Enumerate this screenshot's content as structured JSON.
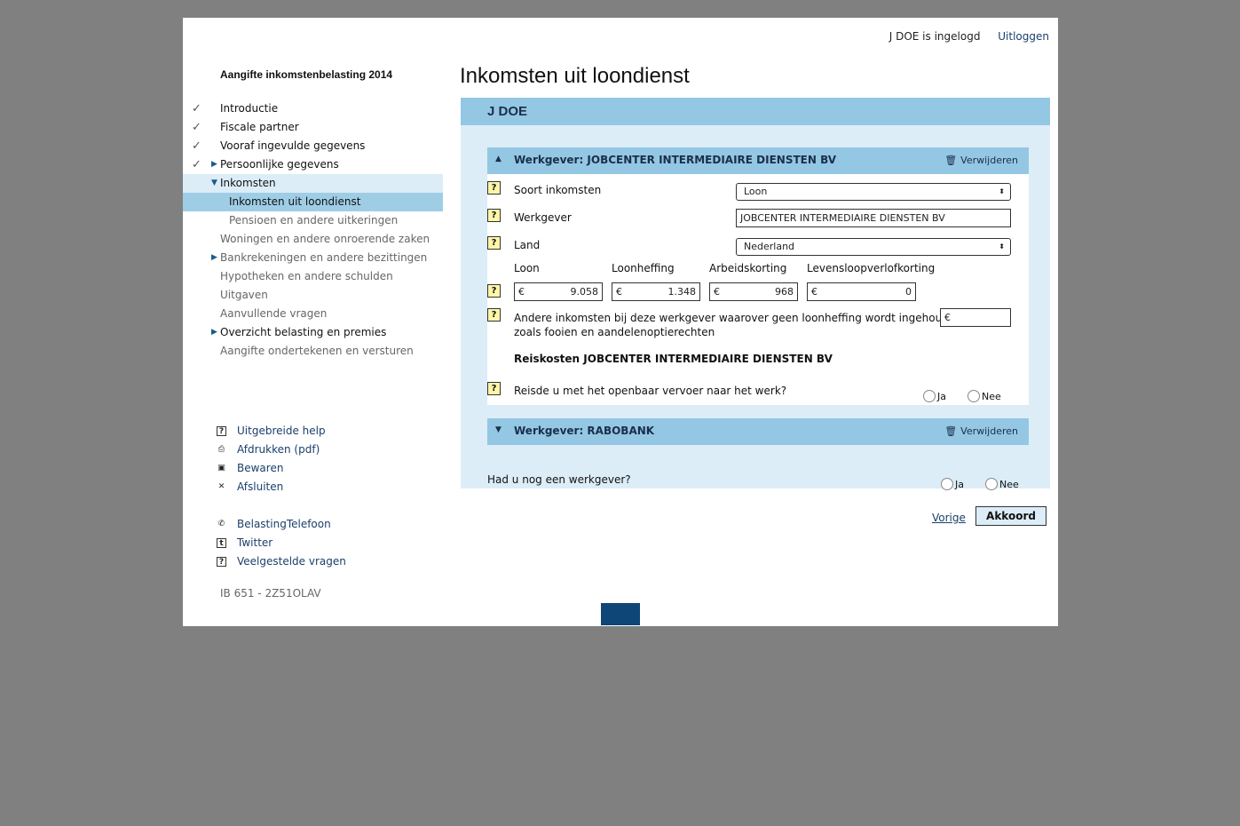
{
  "header": {
    "user_status": "J DOE is ingelogd",
    "logout": "Uitloggen",
    "app_title": "Aangifte inkomstenbelasting 2014"
  },
  "nav": {
    "items": [
      {
        "label": "Introductie",
        "check": "✓",
        "state": "done"
      },
      {
        "label": "Fiscale partner",
        "check": "✓",
        "state": "done"
      },
      {
        "label": "Vooraf ingevulde gegevens",
        "check": "✓",
        "state": "done"
      },
      {
        "label": "Persoonlijke gegevens",
        "check": "✓",
        "state": "done",
        "expander": "▶"
      },
      {
        "label": "Inkomsten",
        "state": "open",
        "expander": "▼"
      },
      {
        "label": "Inkomsten uit loondienst",
        "state": "active",
        "sub": true
      },
      {
        "label": "Pensioen en andere uitkeringen",
        "state": "dim",
        "sub": true
      },
      {
        "label": "Woningen en andere onroerende zaken",
        "state": "dim"
      },
      {
        "label": "Bankrekeningen en andere bezittingen",
        "state": "dim",
        "expander": "▶"
      },
      {
        "label": "Hypotheken en andere schulden",
        "state": "dim"
      },
      {
        "label": "Uitgaven",
        "state": "dim"
      },
      {
        "label": "Aanvullende vragen",
        "state": "dim"
      },
      {
        "label": "Overzicht belasting en premies",
        "state": "normal",
        "expander": "▶"
      },
      {
        "label": "Aangifte ondertekenen en versturen",
        "state": "dim"
      }
    ]
  },
  "tools": [
    {
      "label": "Uitgebreide help",
      "icon": "?",
      "icon_name": "help-icon"
    },
    {
      "label": "Afdrukken (pdf)",
      "icon": "⎙",
      "icon_name": "print-icon"
    },
    {
      "label": "Bewaren",
      "icon": "▣",
      "icon_name": "save-icon"
    },
    {
      "label": "Afsluiten",
      "icon": "✕",
      "icon_name": "close-icon"
    }
  ],
  "links": [
    {
      "label": "BelastingTelefoon",
      "icon": "✆",
      "icon_name": "phone-icon"
    },
    {
      "label": "Twitter",
      "icon": "t",
      "icon_name": "twitter-icon"
    },
    {
      "label": "Veelgestelde vragen",
      "icon": "?",
      "icon_name": "faq-icon"
    }
  ],
  "version": "IB 651 - 2Z51OLAV",
  "main": {
    "title": "Inkomsten uit loondienst",
    "person": "J DOE",
    "employer1": {
      "title": "Werkgever: JOBCENTER INTERMEDIAIRE DIENSTEN BV",
      "toggle": "▲",
      "delete": "Verwijderen",
      "help": "?",
      "soort_label": "Soort inkomsten",
      "soort_value": "Loon",
      "werkgever_label": "Werkgever",
      "werkgever_value": "JOBCENTER INTERMEDIAIRE DIENSTEN BV",
      "land_label": "Land",
      "land_value": "Nederland",
      "select_arrow": "⬍",
      "currency": "€",
      "amounts": [
        {
          "label": "Loon",
          "value": "9.058"
        },
        {
          "label": "Loonheffing",
          "value": "1.348"
        },
        {
          "label": "Arbeidskorting",
          "value": "968"
        },
        {
          "label": "Levensloopverlofkorting",
          "value": "0"
        }
      ],
      "other_income_line1": "Andere inkomsten bij deze werkgever waarover geen loonheffing wordt ingehouden,",
      "other_income_line2": "zoals fooien en aandelenoptierechten",
      "travel_title": "Reiskosten JOBCENTER INTERMEDIAIRE DIENSTEN BV",
      "travel_question": "Reisde u met het openbaar vervoer naar het werk?",
      "yes": "Ja",
      "no": "Nee"
    },
    "employer2": {
      "title": "Werkgever: RABOBANK",
      "toggle": "▼",
      "delete": "Verwijderen"
    },
    "another_question": "Had u nog een werkgever?",
    "yes": "Ja",
    "no": "Nee",
    "prev": "Vorige",
    "accept": "Akkoord"
  }
}
